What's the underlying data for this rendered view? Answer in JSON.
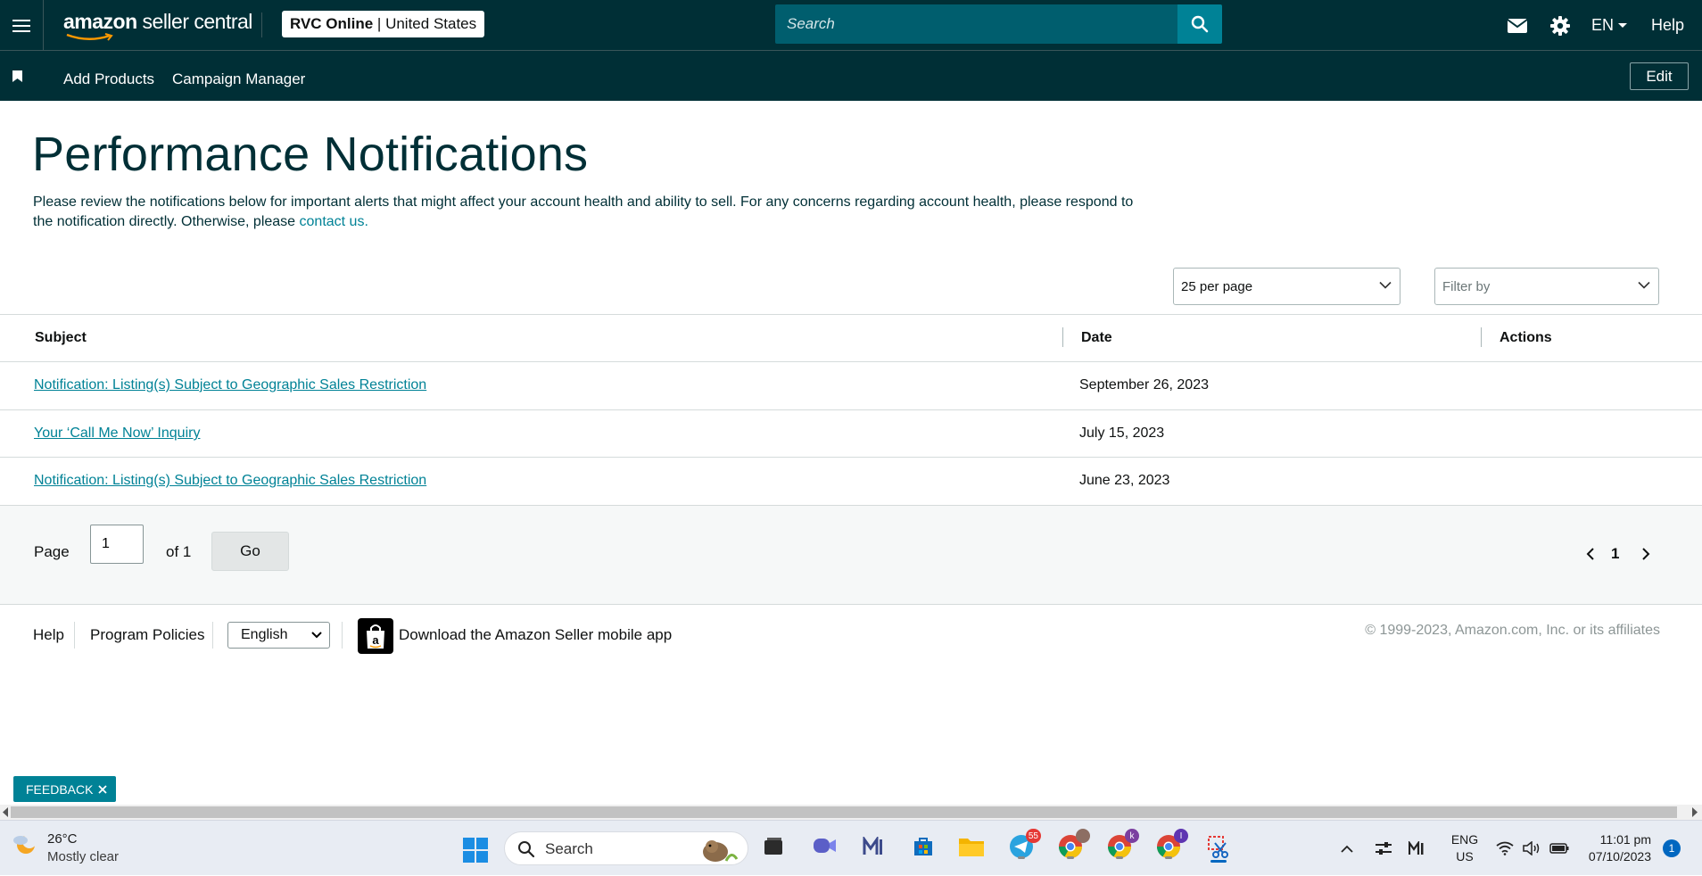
{
  "header": {
    "logo_brand": "amazon",
    "logo_product": "seller central",
    "account_name": "RVC Online",
    "account_region": "United States",
    "search_placeholder": "Search",
    "language": "EN",
    "help": "Help"
  },
  "subnav": {
    "items": [
      "Add Products",
      "Campaign Manager"
    ],
    "edit": "Edit"
  },
  "page": {
    "title": "Performance Notifications",
    "intro_text": "Please review the notifications below for important alerts that might affect your account health and ability to sell. For any concerns regarding account health, please respond to the notification directly. Otherwise, please ",
    "intro_link": "contact us."
  },
  "controls": {
    "per_page": "25 per page",
    "filter_placeholder": "Filter by"
  },
  "table": {
    "columns": [
      "Subject",
      "Date",
      "Actions"
    ],
    "rows": [
      {
        "subject": "Notification: Listing(s) Subject to Geographic Sales Restriction",
        "date": "September 26, 2023"
      },
      {
        "subject": "Your ‘Call Me Now’ Inquiry",
        "date": "July 15, 2023"
      },
      {
        "subject": "Notification: Listing(s) Subject to Geographic Sales Restriction",
        "date": "June 23, 2023"
      }
    ]
  },
  "pagination": {
    "page_label": "Page",
    "page_value": "1",
    "of_label": "of 1",
    "go": "Go",
    "current": "1"
  },
  "footer": {
    "help": "Help",
    "program_policies": "Program Policies",
    "language": "English",
    "download_app": "Download the Amazon Seller mobile app",
    "copyright": "© 1999-2023, Amazon.com, Inc. or its affiliates"
  },
  "feedback": "FEEDBACK",
  "taskbar": {
    "temperature": "26°C",
    "weather": "Mostly clear",
    "search": "Search",
    "telegram_badge": "55",
    "chrome2_badge": "k",
    "chrome3_badge": "I",
    "lang_top": "ENG",
    "lang_bottom": "US",
    "time": "11:01 pm",
    "date": "07/10/2023",
    "notifications": "1"
  },
  "colors": {
    "header_bg": "#002f36",
    "link": "#008296",
    "search_bg": "#005e6e"
  }
}
